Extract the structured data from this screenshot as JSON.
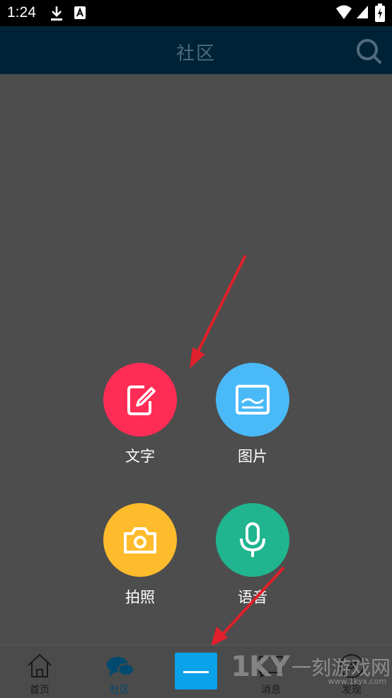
{
  "status_bar": {
    "time": "1:24",
    "icons": [
      "download-icon",
      "a-badge-icon",
      "wifi-icon",
      "signal-icon",
      "battery-icon"
    ]
  },
  "app_bar": {
    "title": "社区",
    "search_icon": "search-icon"
  },
  "actions": [
    {
      "label": "文字",
      "icon": "edit-note-icon",
      "color": "#ff2d55"
    },
    {
      "label": "图片",
      "icon": "image-icon",
      "color": "#4ab9f8"
    },
    {
      "label": "拍照",
      "icon": "camera-icon",
      "color": "#febb2c"
    },
    {
      "label": "语音",
      "icon": "microphone-icon",
      "color": "#20b58f"
    }
  ],
  "annotation_color": "#e0202a",
  "bottom_nav": {
    "items": [
      {
        "label": "首页",
        "icon": "home-icon"
      },
      {
        "label": "社区",
        "icon": "chat-bubbles-icon"
      },
      {
        "label": "",
        "icon": "minus-icon"
      },
      {
        "label": "消息",
        "icon": "message-icon"
      },
      {
        "label": "发现",
        "icon": "compass-icon"
      }
    ]
  },
  "watermark": {
    "logo": "1KY",
    "text": "一刻游戏网",
    "url": "www.1kyx.com"
  }
}
